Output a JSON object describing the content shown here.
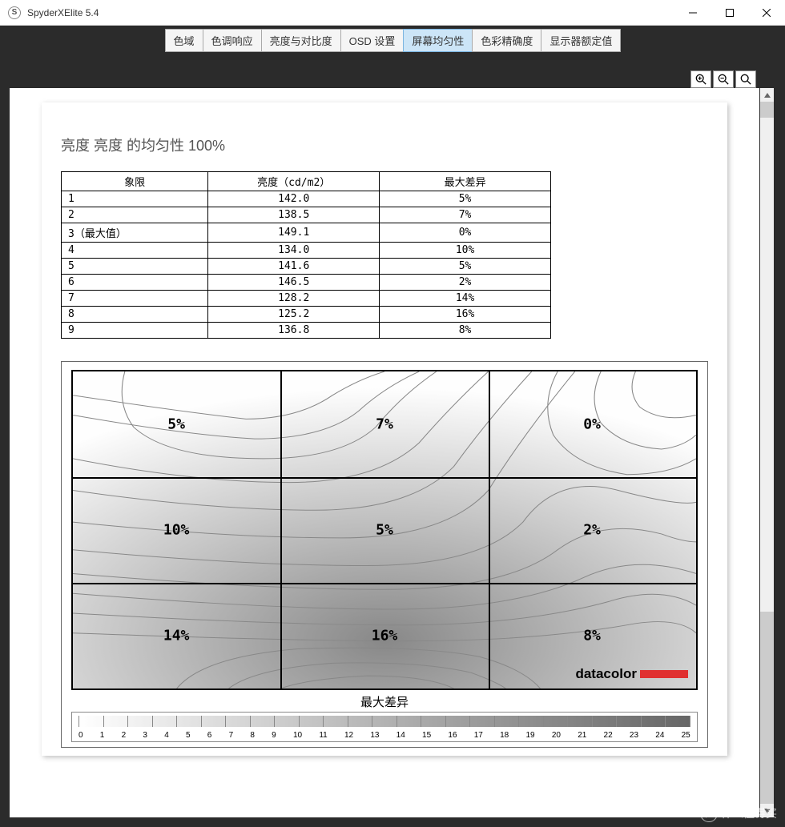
{
  "window": {
    "title": "SpyderXElite 5.4",
    "app_icon_text": "S"
  },
  "tabs": [
    {
      "label": "色域"
    },
    {
      "label": "色调响应"
    },
    {
      "label": "亮度与对比度"
    },
    {
      "label": "OSD 设置"
    },
    {
      "label": "屏幕均匀性",
      "active": true
    },
    {
      "label": "色彩精确度"
    },
    {
      "label": "显示器额定值"
    }
  ],
  "report": {
    "title": "亮度 亮度 的均匀性 100%",
    "table": {
      "headers": [
        "象限",
        "亮度（cd/m2）",
        "最大差异"
      ],
      "rows": [
        [
          "1",
          "142.0",
          "5%"
        ],
        [
          "2",
          "138.5",
          "7%"
        ],
        [
          "3（最大值）",
          "149.1",
          "0%"
        ],
        [
          "4",
          "134.0",
          "10%"
        ],
        [
          "5",
          "141.6",
          "5%"
        ],
        [
          "6",
          "146.5",
          "2%"
        ],
        [
          "7",
          "128.2",
          "14%"
        ],
        [
          "8",
          "125.2",
          "16%"
        ],
        [
          "9",
          "136.8",
          "8%"
        ]
      ]
    },
    "grid_labels": [
      "5%",
      "7%",
      "0%",
      "10%",
      "5%",
      "2%",
      "14%",
      "16%",
      "8%"
    ],
    "brand": "datacolor",
    "chart_caption": "最大差异",
    "legend_ticks": [
      "0",
      "1",
      "2",
      "3",
      "4",
      "5",
      "6",
      "7",
      "8",
      "9",
      "10",
      "11",
      "12",
      "13",
      "14",
      "15",
      "16",
      "17",
      "18",
      "19",
      "20",
      "21",
      "22",
      "23",
      "24",
      "25"
    ]
  },
  "watermark": {
    "circ": "值",
    "text": "什么值得买"
  },
  "chart_data": {
    "type": "heatmap",
    "title": "亮度 亮度 的均匀性 100%",
    "xlabel": "",
    "ylabel": "",
    "caption": "最大差异",
    "grid": {
      "rows": 3,
      "cols": 3
    },
    "values_percent": [
      [
        5,
        7,
        0
      ],
      [
        10,
        5,
        2
      ],
      [
        14,
        16,
        8
      ]
    ],
    "luminance_cd_m2": [
      [
        142.0,
        138.5,
        149.1
      ],
      [
        134.0,
        141.6,
        146.5
      ],
      [
        128.2,
        125.2,
        136.8
      ]
    ],
    "colorscale": {
      "min": 0,
      "max": 25,
      "unit": "%"
    }
  }
}
